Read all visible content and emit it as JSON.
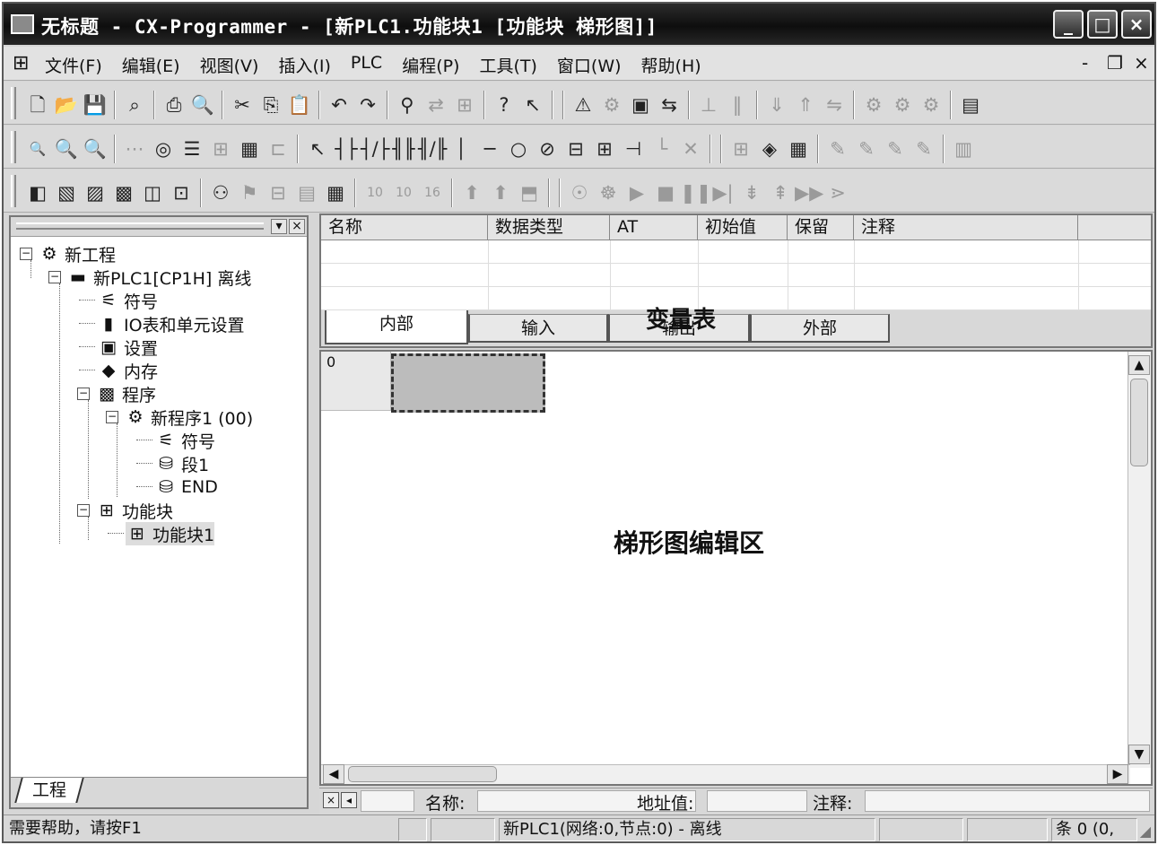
{
  "window": {
    "title": "无标题 - CX-Programmer - [新PLC1.功能块1 [功能块 梯形图]]",
    "minimize": "_",
    "maximize": "□",
    "close": "×"
  },
  "menu": {
    "items": [
      "文件(F)",
      "编辑(E)",
      "视图(V)",
      "插入(I)",
      "PLC",
      "编程(P)",
      "工具(T)",
      "窗口(W)",
      "帮助(H)"
    ],
    "mdi_min": "-",
    "mdi_restore": "❐",
    "mdi_close": "×"
  },
  "tree": {
    "root": "新工程",
    "plc": "新PLC1[CP1H] 离线",
    "symbols": "符号",
    "io": "IO表和单元设置",
    "settings": "设置",
    "memory": "内存",
    "programs": "程序",
    "newprog": "新程序1 (00)",
    "prog_symbols": "符号",
    "section": "段1",
    "end": "END",
    "fb": "功能块",
    "fb1": "功能块1",
    "tab": "工程"
  },
  "vartable": {
    "columns": [
      "名称",
      "数据类型",
      "AT",
      "初始值",
      "保留",
      "注释"
    ],
    "tabs": [
      "内部",
      "输入",
      "输出",
      "外部"
    ],
    "caption": "变量表"
  },
  "editor": {
    "rung_number": "0",
    "caption": "梯形图编辑区"
  },
  "infobar": {
    "name_label": "名称:",
    "address_label": "地址值:",
    "comment_label": "注释:"
  },
  "status": {
    "help": "需要帮助，请按F1",
    "plc": "新PLC1(网络:0,节点:0) - 离线",
    "position": "条 0 (0,"
  }
}
